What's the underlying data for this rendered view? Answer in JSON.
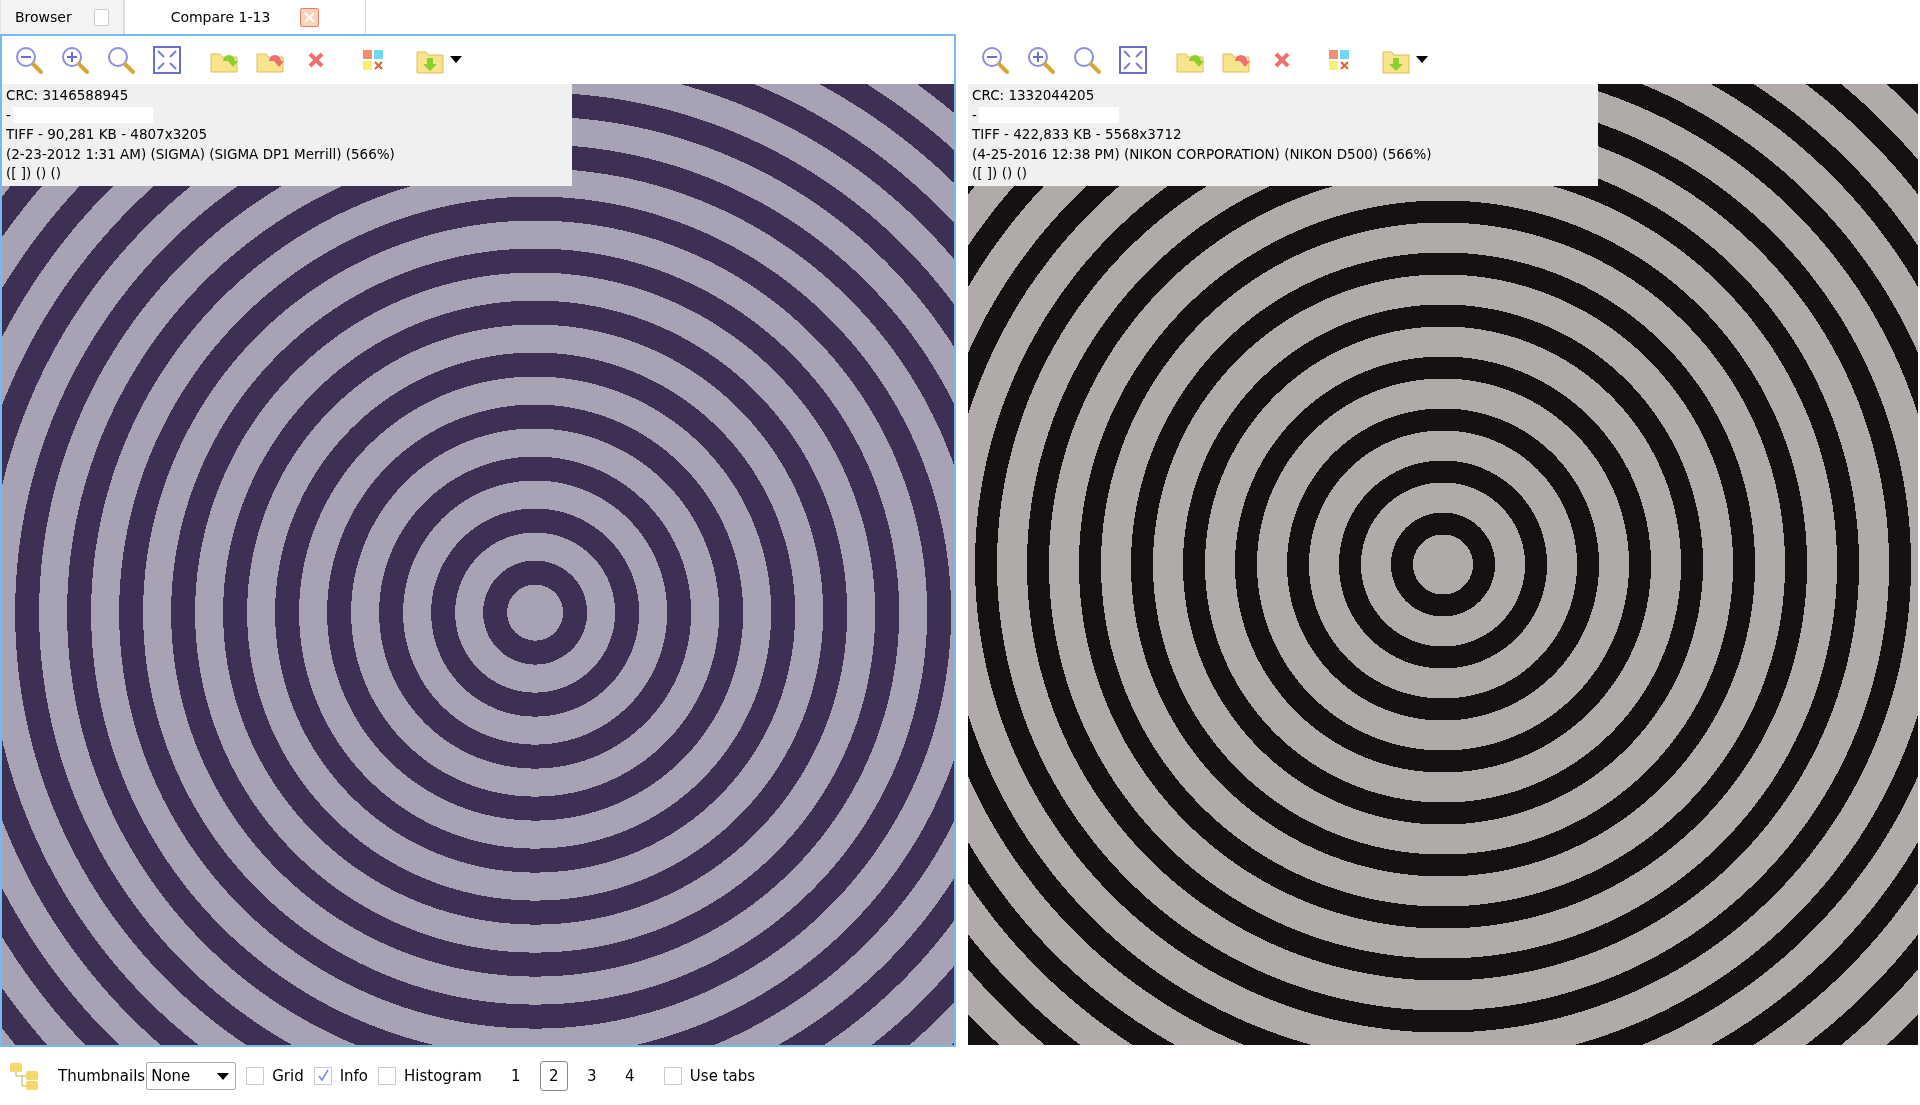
{
  "tabs": [
    {
      "label": "Browser",
      "selected": false,
      "kind": "checkbox"
    },
    {
      "label": "Compare 1-13",
      "selected": true,
      "kind": "close"
    }
  ],
  "panels": [
    {
      "active": true,
      "info_lines": [
        "CRC: 3146588945",
        "-",
        "TIFF - 90,281 KB - 4807x3205",
        "(2-23-2012 1:31 AM) (SIGMA) (SIGMA DP1 Merrill) (566%)",
        "([ ]) () ()"
      ]
    },
    {
      "active": false,
      "info_lines": [
        "CRC: 1332044205",
        "-",
        "TIFF - 422,833 KB - 5568x3712",
        "(4-25-2016 12:38 PM) (NIKON CORPORATION) (NIKON D500) (566%)",
        "([ ]) () ()"
      ]
    }
  ],
  "bottom_bar": {
    "thumbnails_label": "Thumbnails",
    "thumbnails_value": "None",
    "options": [
      {
        "label": "Grid",
        "checked": false
      },
      {
        "label": "Info",
        "checked": true
      },
      {
        "label": "Histogram",
        "checked": false
      }
    ],
    "pages": [
      {
        "label": "1",
        "selected": false
      },
      {
        "label": "2",
        "selected": true
      },
      {
        "label": "3",
        "selected": false
      },
      {
        "label": "4",
        "selected": false
      }
    ],
    "use_tabs": {
      "label": "Use tabs",
      "checked": false
    }
  }
}
